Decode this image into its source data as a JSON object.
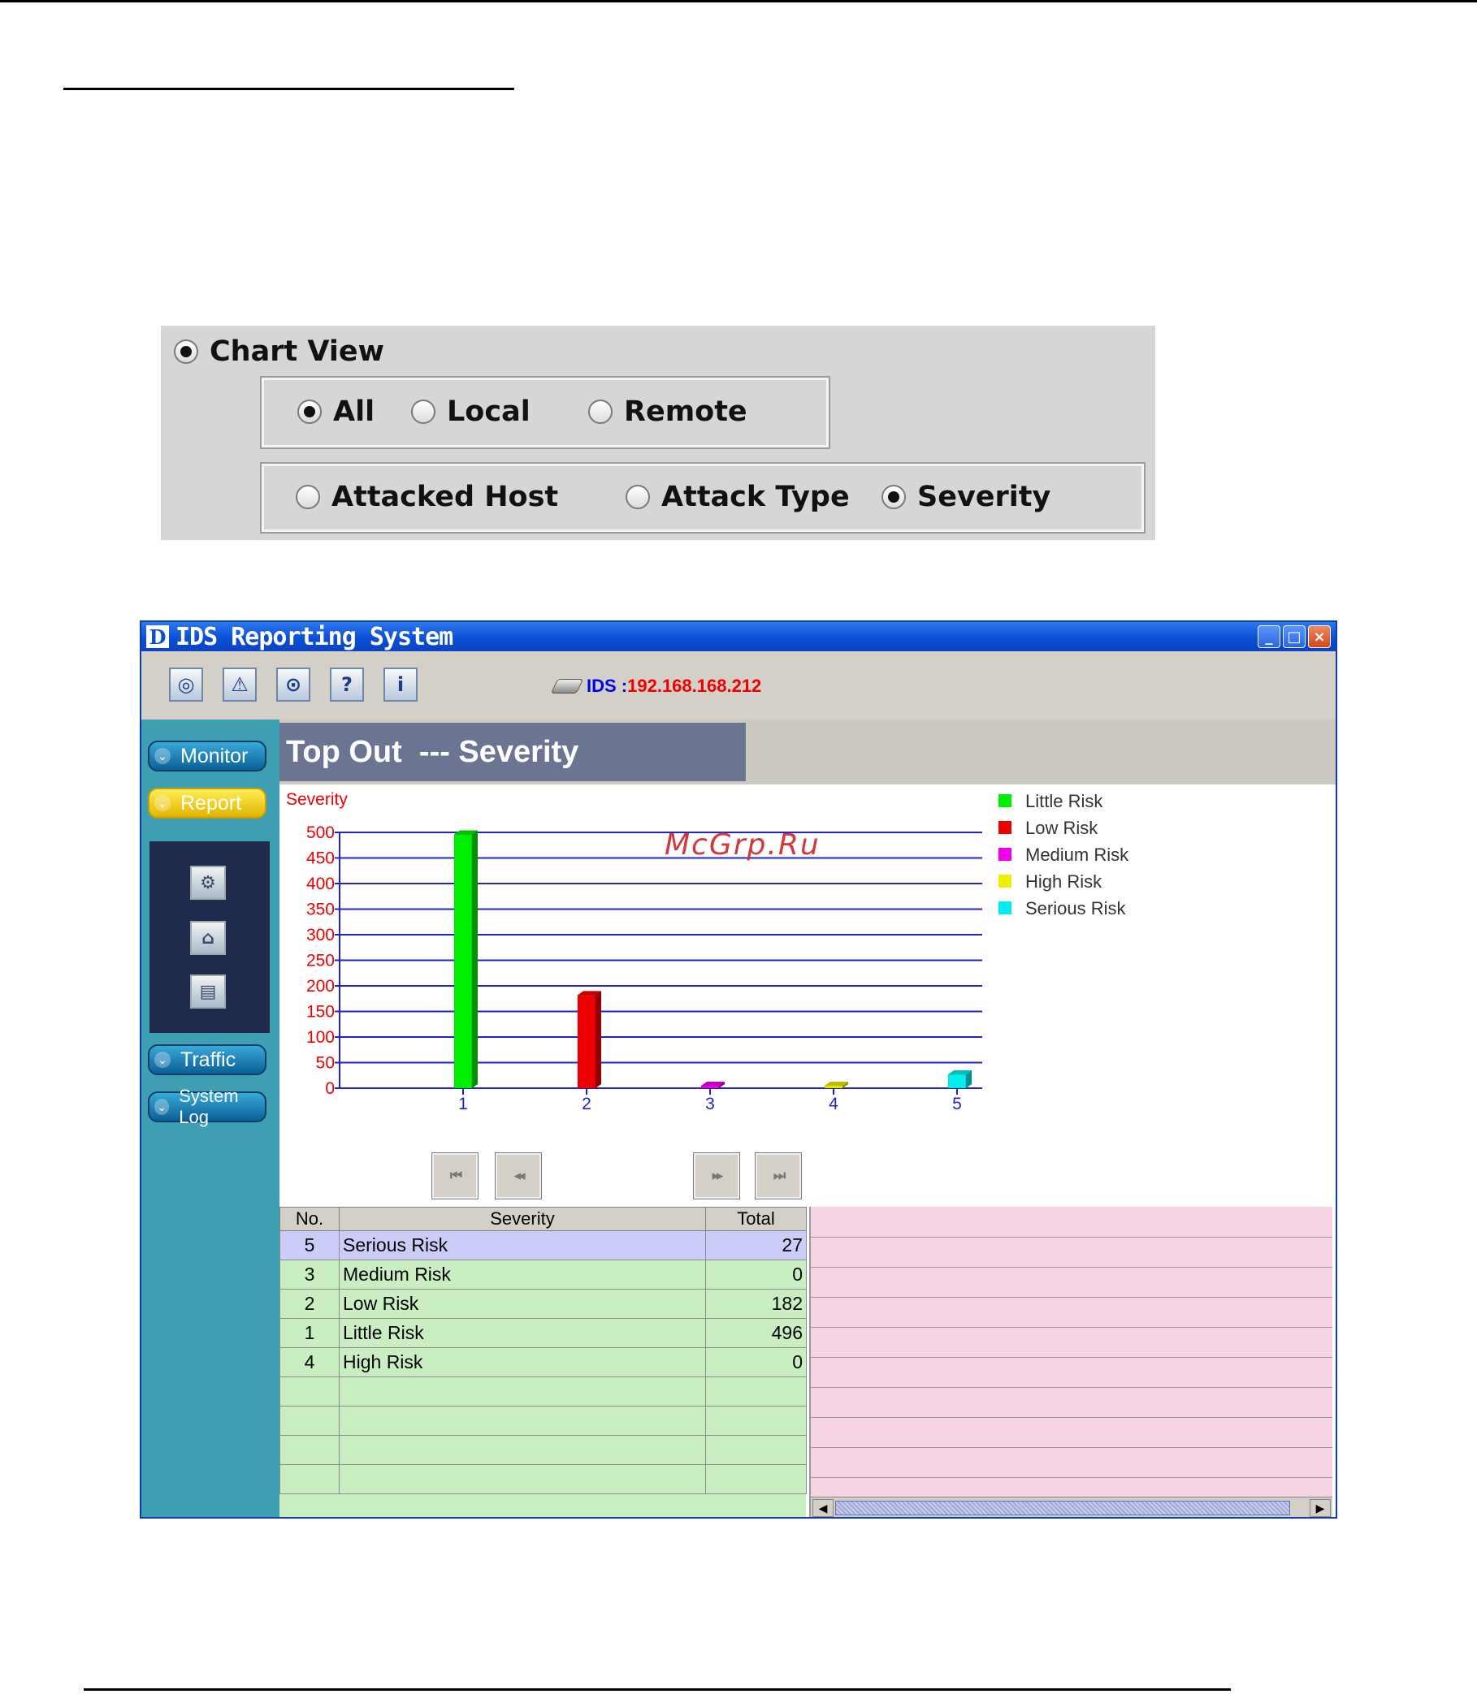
{
  "options": {
    "view_label": "Chart View",
    "scope": [
      "All",
      "Local",
      "Remote"
    ],
    "scope_selected": "All",
    "category": [
      "Attacked Host",
      "Attack Type",
      "Severity"
    ],
    "category_selected": "Severity"
  },
  "window": {
    "logo": "D",
    "title": "IDS Reporting System",
    "controls": [
      "minimize-icon",
      "maximize-icon",
      "close-icon"
    ]
  },
  "toolbar": {
    "icons": [
      "globe-icon",
      "alert-icon",
      "camera-icon",
      "help-icon",
      "info-icon"
    ],
    "ids_label": "IDS :",
    "ids_ip": "192.168.168.212"
  },
  "sidebar": {
    "buttons": [
      "Monitor",
      "Report",
      "Traffic",
      "System Log"
    ],
    "active": "Report",
    "report_icons": [
      "chart-icon",
      "home-chart-icon",
      "printer-icon"
    ]
  },
  "header": {
    "title": "Top Out  --- Severity"
  },
  "watermark": "McGrp.Ru",
  "chart_data": {
    "type": "bar",
    "ylabel": "Severity",
    "ylim": [
      0,
      500
    ],
    "yticks": [
      0,
      50,
      100,
      150,
      200,
      250,
      300,
      350,
      400,
      450,
      500
    ],
    "categories": [
      "1",
      "2",
      "3",
      "4",
      "5"
    ],
    "values": [
      496,
      182,
      0,
      0,
      27
    ],
    "colors": [
      "#00ee00",
      "#ee0000",
      "#ee00ee",
      "#eeee00",
      "#00eeee"
    ],
    "legend": [
      {
        "name": "Little Risk",
        "color": "#00ee00"
      },
      {
        "name": "Low Risk",
        "color": "#ee0000"
      },
      {
        "name": "Medium Risk",
        "color": "#ee00ee"
      },
      {
        "name": "High Risk",
        "color": "#eeee00"
      },
      {
        "name": "Serious Risk",
        "color": "#00eeee"
      }
    ],
    "legend_position": "top-right",
    "grid": true
  },
  "pager": [
    "first-icon",
    "prev-icon",
    "next-icon",
    "last-icon"
  ],
  "table": {
    "columns": [
      "No.",
      "Severity",
      "Total"
    ],
    "rows": [
      {
        "no": "5",
        "severity": "Serious Risk",
        "total": "27"
      },
      {
        "no": "3",
        "severity": "Medium Risk",
        "total": "0"
      },
      {
        "no": "2",
        "severity": "Low Risk",
        "total": "182"
      },
      {
        "no": "1",
        "severity": "Little Risk",
        "total": "496"
      },
      {
        "no": "4",
        "severity": "High Risk",
        "total": "0"
      }
    ],
    "selected_row": 0
  }
}
